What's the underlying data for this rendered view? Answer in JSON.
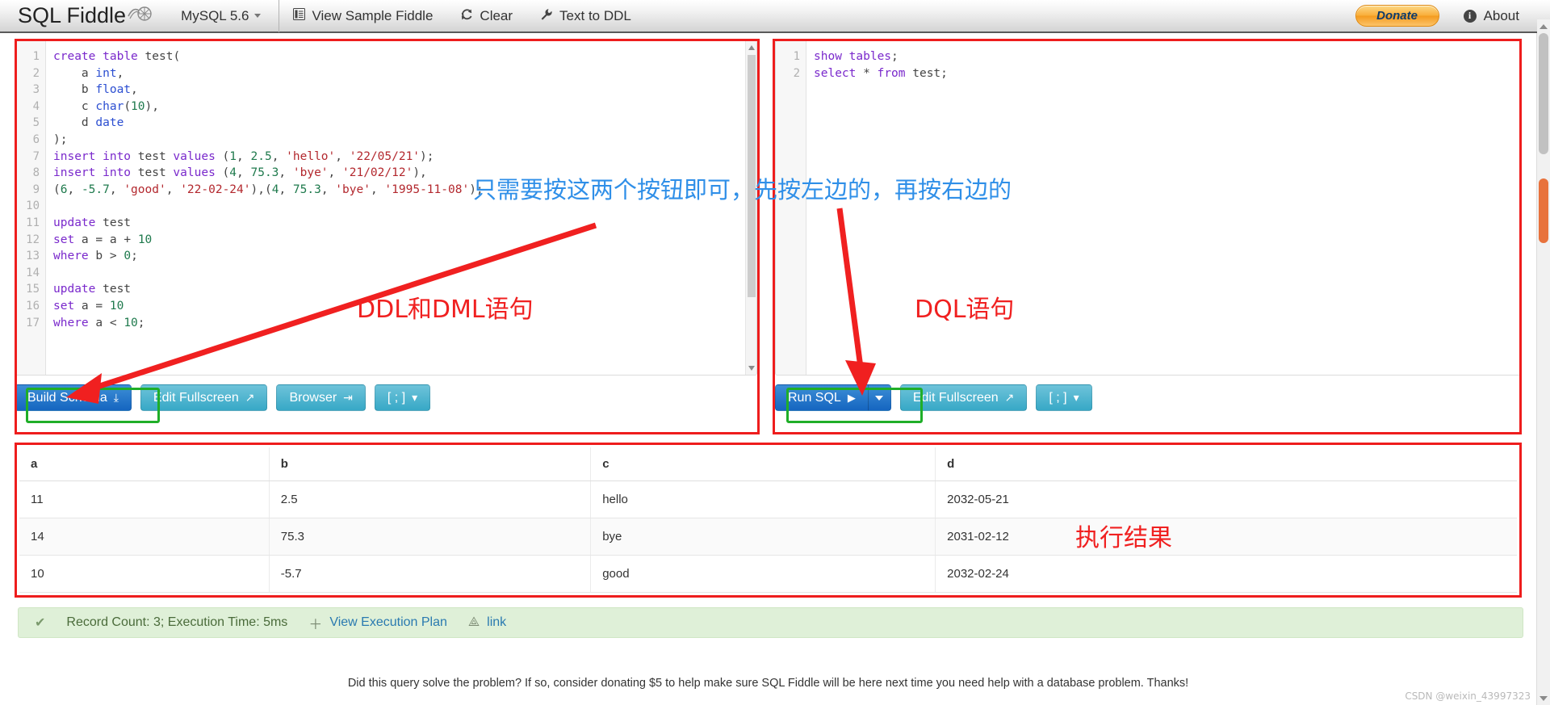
{
  "navbar": {
    "brand": "SQL Fiddle",
    "brand_logo_icon": "fiddle-shell-icon",
    "db_engine": "MySQL 5.6",
    "db_caret_icon": "chevron-down-icon",
    "items": [
      {
        "label": "View Sample Fiddle",
        "icon": "document-list-icon",
        "glyph": "▤"
      },
      {
        "label": "Clear",
        "icon": "refresh-icon",
        "glyph": "⟳"
      },
      {
        "label": "Text to DDL",
        "icon": "wrench-icon",
        "glyph": "ὒ7"
      }
    ],
    "donate_label": "Donate",
    "about_label": "About",
    "about_icon": "info-circle-icon"
  },
  "left_panel": {
    "name": "schema-editor",
    "lines": [
      {
        "n": "1",
        "tokens": [
          {
            "t": "create",
            "c": "kw"
          },
          {
            "t": " ",
            "c": "pun"
          },
          {
            "t": "table",
            "c": "kw"
          },
          {
            "t": " test",
            "c": "pun"
          },
          {
            "t": "(",
            "c": "pun"
          }
        ]
      },
      {
        "n": "2",
        "tokens": [
          {
            "t": "    a ",
            "c": "pun"
          },
          {
            "t": "int",
            "c": "typ"
          },
          {
            "t": ",",
            "c": "pun"
          }
        ]
      },
      {
        "n": "3",
        "tokens": [
          {
            "t": "    b ",
            "c": "pun"
          },
          {
            "t": "float",
            "c": "typ"
          },
          {
            "t": ",",
            "c": "pun"
          }
        ]
      },
      {
        "n": "4",
        "tokens": [
          {
            "t": "    c ",
            "c": "pun"
          },
          {
            "t": "char",
            "c": "typ"
          },
          {
            "t": "(",
            "c": "pun"
          },
          {
            "t": "10",
            "c": "num"
          },
          {
            "t": "),",
            "c": "pun"
          }
        ]
      },
      {
        "n": "5",
        "tokens": [
          {
            "t": "    d ",
            "c": "pun"
          },
          {
            "t": "date",
            "c": "typ"
          }
        ]
      },
      {
        "n": "6",
        "tokens": [
          {
            "t": ");",
            "c": "pun"
          }
        ]
      },
      {
        "n": "7",
        "tokens": [
          {
            "t": "insert into",
            "c": "kw"
          },
          {
            "t": " test ",
            "c": "pun"
          },
          {
            "t": "values",
            "c": "kw"
          },
          {
            "t": " (",
            "c": "pun"
          },
          {
            "t": "1",
            "c": "num"
          },
          {
            "t": ", ",
            "c": "pun"
          },
          {
            "t": "2.5",
            "c": "num"
          },
          {
            "t": ", ",
            "c": "pun"
          },
          {
            "t": "'hello'",
            "c": "str"
          },
          {
            "t": ", ",
            "c": "pun"
          },
          {
            "t": "'22/05/21'",
            "c": "str"
          },
          {
            "t": ");",
            "c": "pun"
          }
        ]
      },
      {
        "n": "8",
        "tokens": [
          {
            "t": "insert into",
            "c": "kw"
          },
          {
            "t": " test ",
            "c": "pun"
          },
          {
            "t": "values",
            "c": "kw"
          },
          {
            "t": " (",
            "c": "pun"
          },
          {
            "t": "4",
            "c": "num"
          },
          {
            "t": ", ",
            "c": "pun"
          },
          {
            "t": "75.3",
            "c": "num"
          },
          {
            "t": ", ",
            "c": "pun"
          },
          {
            "t": "'bye'",
            "c": "str"
          },
          {
            "t": ", ",
            "c": "pun"
          },
          {
            "t": "'21/02/12'",
            "c": "str"
          },
          {
            "t": "),",
            "c": "pun"
          }
        ]
      },
      {
        "n": "9",
        "tokens": [
          {
            "t": "(",
            "c": "pun"
          },
          {
            "t": "6",
            "c": "num"
          },
          {
            "t": ", ",
            "c": "pun"
          },
          {
            "t": "-5.7",
            "c": "num"
          },
          {
            "t": ", ",
            "c": "pun"
          },
          {
            "t": "'good'",
            "c": "str"
          },
          {
            "t": ", ",
            "c": "pun"
          },
          {
            "t": "'22-02-24'",
            "c": "str"
          },
          {
            "t": "),(",
            "c": "pun"
          },
          {
            "t": "4",
            "c": "num"
          },
          {
            "t": ", ",
            "c": "pun"
          },
          {
            "t": "75.3",
            "c": "num"
          },
          {
            "t": ", ",
            "c": "pun"
          },
          {
            "t": "'bye'",
            "c": "str"
          },
          {
            "t": ", ",
            "c": "pun"
          },
          {
            "t": "'1995-11-08'",
            "c": "str"
          },
          {
            "t": ");",
            "c": "pun"
          }
        ]
      },
      {
        "n": "10",
        "tokens": []
      },
      {
        "n": "11",
        "tokens": [
          {
            "t": "update",
            "c": "kw"
          },
          {
            "t": " test",
            "c": "pun"
          }
        ]
      },
      {
        "n": "12",
        "tokens": [
          {
            "t": "set",
            "c": "kw"
          },
          {
            "t": " a ",
            "c": "pun"
          },
          {
            "t": "=",
            "c": "opr"
          },
          {
            "t": " a ",
            "c": "pun"
          },
          {
            "t": "+",
            "c": "opr"
          },
          {
            "t": " ",
            "c": "pun"
          },
          {
            "t": "10",
            "c": "num"
          }
        ]
      },
      {
        "n": "13",
        "tokens": [
          {
            "t": "where",
            "c": "kw"
          },
          {
            "t": " b ",
            "c": "pun"
          },
          {
            "t": ">",
            "c": "opr"
          },
          {
            "t": " ",
            "c": "pun"
          },
          {
            "t": "0",
            "c": "num"
          },
          {
            "t": ";",
            "c": "pun"
          }
        ]
      },
      {
        "n": "14",
        "tokens": []
      },
      {
        "n": "15",
        "tokens": [
          {
            "t": "update",
            "c": "kw"
          },
          {
            "t": " test",
            "c": "pun"
          }
        ]
      },
      {
        "n": "16",
        "tokens": [
          {
            "t": "set",
            "c": "kw"
          },
          {
            "t": " a ",
            "c": "pun"
          },
          {
            "t": "=",
            "c": "opr"
          },
          {
            "t": " ",
            "c": "pun"
          },
          {
            "t": "10",
            "c": "num"
          }
        ]
      },
      {
        "n": "17",
        "tokens": [
          {
            "t": "where",
            "c": "kw"
          },
          {
            "t": " a ",
            "c": "pun"
          },
          {
            "t": "<",
            "c": "opr"
          },
          {
            "t": " ",
            "c": "pun"
          },
          {
            "t": "10",
            "c": "num"
          },
          {
            "t": ";",
            "c": "pun"
          }
        ]
      }
    ],
    "buttons": [
      {
        "label": "Build Schema",
        "icon": "download-icon",
        "glyph": "⤓",
        "style": "primary"
      },
      {
        "label": "Edit Fullscreen",
        "icon": "expand-arrow-icon",
        "glyph": "↗",
        "style": "info"
      },
      {
        "label": "Browser",
        "icon": "indent-list-icon",
        "glyph": "⇥",
        "style": "info"
      },
      {
        "label": "[ ; ]",
        "icon": "chevron-down-icon",
        "glyph": "▾",
        "style": "info"
      }
    ]
  },
  "right_panel": {
    "name": "query-editor",
    "lines": [
      {
        "n": "1",
        "tokens": [
          {
            "t": "show",
            "c": "kw"
          },
          {
            "t": " ",
            "c": "pun"
          },
          {
            "t": "tables",
            "c": "kw"
          },
          {
            "t": ";",
            "c": "pun"
          }
        ]
      },
      {
        "n": "2",
        "tokens": [
          {
            "t": "select",
            "c": "kw"
          },
          {
            "t": " ",
            "c": "pun"
          },
          {
            "t": "*",
            "c": "opr"
          },
          {
            "t": " ",
            "c": "pun"
          },
          {
            "t": "from",
            "c": "kw"
          },
          {
            "t": " test",
            "c": "pun"
          },
          {
            "t": ";",
            "c": "pun"
          }
        ]
      }
    ],
    "run_label": "Run SQL",
    "run_icon": "play-icon",
    "run_glyph": "▶",
    "run_caret_icon": "chevron-down-icon",
    "buttons": [
      {
        "label": "Edit Fullscreen",
        "icon": "expand-arrow-icon",
        "glyph": "↗",
        "style": "info"
      },
      {
        "label": "[ ; ]",
        "icon": "chevron-down-icon",
        "glyph": "▾",
        "style": "info"
      }
    ]
  },
  "results": {
    "columns": [
      "a",
      "b",
      "c",
      "d"
    ],
    "rows": [
      [
        "11",
        "2.5",
        "hello",
        "2032-05-21"
      ],
      [
        "14",
        "75.3",
        "bye",
        "2031-02-12"
      ],
      [
        "10",
        "-5.7",
        "good",
        "2032-02-24"
      ]
    ]
  },
  "status": {
    "check_icon": "check-icon",
    "check_glyph": "✔",
    "text": "Record Count: 3; Execution Time: 5ms",
    "plan_link": "View Execution Plan",
    "plan_icon": "plus-icon",
    "plan_glyph": "＋",
    "share_link": "link",
    "share_icon": "arrow-share-icon",
    "share_glyph": "↗"
  },
  "footer_note": "Did this query solve the problem? If so, consider donating $5 to help make sure SQL Fiddle will be here next time you need help with a database problem. Thanks!",
  "annotations": {
    "blue_instruction": "只需要按这两个按钮即可，先按左边的，再按右边的",
    "ddl_dml_label": "DDL和DML语句",
    "dql_label": "DQL语句",
    "result_label": "执行结果",
    "highlight_color": "#ee1d1d",
    "button_ring_color": "#1fae28",
    "instruction_color": "#2f8fe8"
  },
  "watermark": "CSDN @weixin_43997323"
}
